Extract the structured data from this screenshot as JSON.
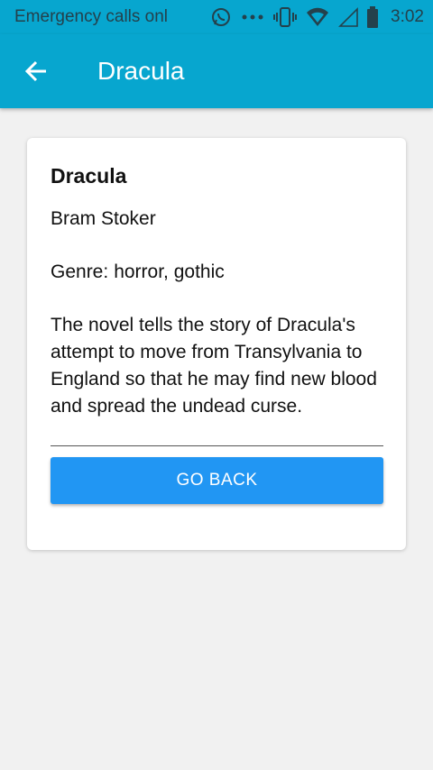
{
  "status_bar": {
    "carrier_text": "Emergency calls onl",
    "time": "3:02",
    "icons": [
      "whatsapp-icon",
      "more-dots-icon",
      "vibrate-icon",
      "wifi-icon",
      "signal-icon",
      "battery-icon"
    ]
  },
  "app_bar": {
    "title": "Dracula",
    "back_icon": "arrow-back-icon"
  },
  "book": {
    "title": "Dracula",
    "author": "Bram Stoker",
    "genre_label": "Genre:",
    "genre": "horror, gothic",
    "description": "The novel tells the story of Dracula's attempt to move from Transylvania to England so that he may find new blood and spread the undead curse."
  },
  "actions": {
    "go_back_label": "GO BACK"
  },
  "colors": {
    "app_bar": "#07a6cf",
    "button": "#2196f3",
    "background": "#f1f1f1"
  }
}
